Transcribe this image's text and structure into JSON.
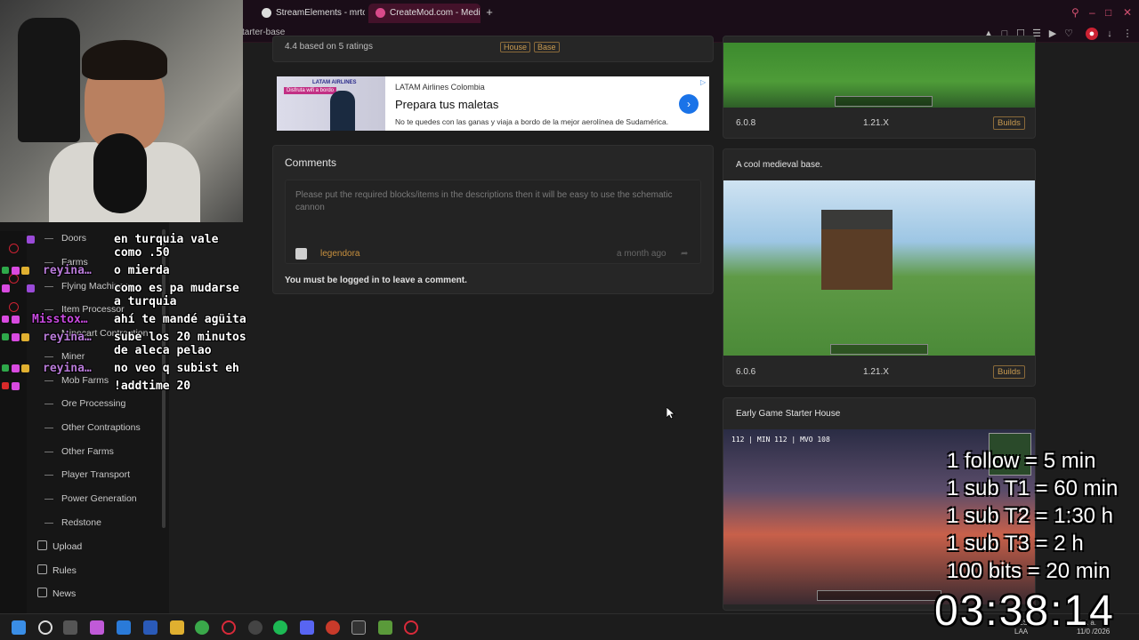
{
  "browser": {
    "tabs": [
      {
        "label": "StreamElements - mrtoma",
        "icon_color": "#dddddd"
      },
      {
        "label": "CreateMod.com - Medieva",
        "icon_color": "#d84a8a"
      }
    ],
    "url": "tarter-base"
  },
  "sidebar": {
    "sub_items": [
      "Doors",
      "Farms",
      "Flying Machines",
      "Item Processor",
      "Minecart Contraption",
      "Miner",
      "Mob Farms",
      "Ore Processing",
      "Other Contraptions",
      "Other Farms",
      "Player Transport",
      "Power Generation",
      "Redstone"
    ],
    "main_items": [
      "Upload",
      "Rules",
      "News"
    ]
  },
  "chat": [
    {
      "name": "",
      "name_color": "#9a4ad8",
      "msg": "en turquia vale\ncomo .50"
    },
    {
      "name": "reyina…",
      "name_color": "#b87ad8",
      "msg": "o mierda"
    },
    {
      "name": "",
      "name_color": "#9a4ad8",
      "msg": "como es pa mudarse\na turquia"
    },
    {
      "name": "Misstox…",
      "name_color": "#c84ae0",
      "msg": "ahí te mandé agüita"
    },
    {
      "name": "reyina…",
      "name_color": "#b87ad8",
      "msg": "sube los 20 minutos\nde aleca pelao"
    },
    {
      "name": "reyina…",
      "name_color": "#b87ad8",
      "msg": "no veo q subist eh"
    },
    {
      "name": "",
      "name_color": "#d82a2a",
      "msg": "!addtime 20"
    }
  ],
  "listing": {
    "rating_text": "4.4 based on 5 ratings",
    "tags": [
      "House",
      "Base"
    ]
  },
  "ad": {
    "brand": "LATAM Airlines Colombia",
    "title": "Prepara tus maletas",
    "body": "No te quedes con las ganas y viaja a bordo de la mejor aerolínea de Sudamérica.",
    "image_logo": "LATAM AIRLINES",
    "image_badge": "Disfruta wifi a bordo"
  },
  "comments": {
    "title": "Comments",
    "comment_text": "Please put the required blocks/items in the descriptions then it will be easy to use the schematic cannon",
    "user": "legendora",
    "time": "a month ago",
    "login_note": "You must be logged in to leave a comment."
  },
  "builds": [
    {
      "title": "",
      "version": "6.0.8",
      "mc": "1.21.X",
      "tag": "Builds"
    },
    {
      "title": "A cool medieval base.",
      "version": "6.0.6",
      "mc": "1.21.X",
      "tag": "Builds"
    },
    {
      "title": "Early Game Starter House",
      "version": "",
      "mc": "",
      "tag": ""
    }
  ],
  "game_hud": "112 | MIN 112 | MVO 108",
  "overlay": {
    "lines": [
      "1 follow = 5 min",
      "1 sub T1 = 60 min",
      "1 sub T2 = 1:30 h",
      "1 sub T3 = 2 h",
      "100 bits = 20 min"
    ],
    "timer": "03:38:14"
  },
  "taskbar": {
    "lang": "ES\nLAA",
    "time": "2:1 a.",
    "date": "11/0 /2026"
  }
}
